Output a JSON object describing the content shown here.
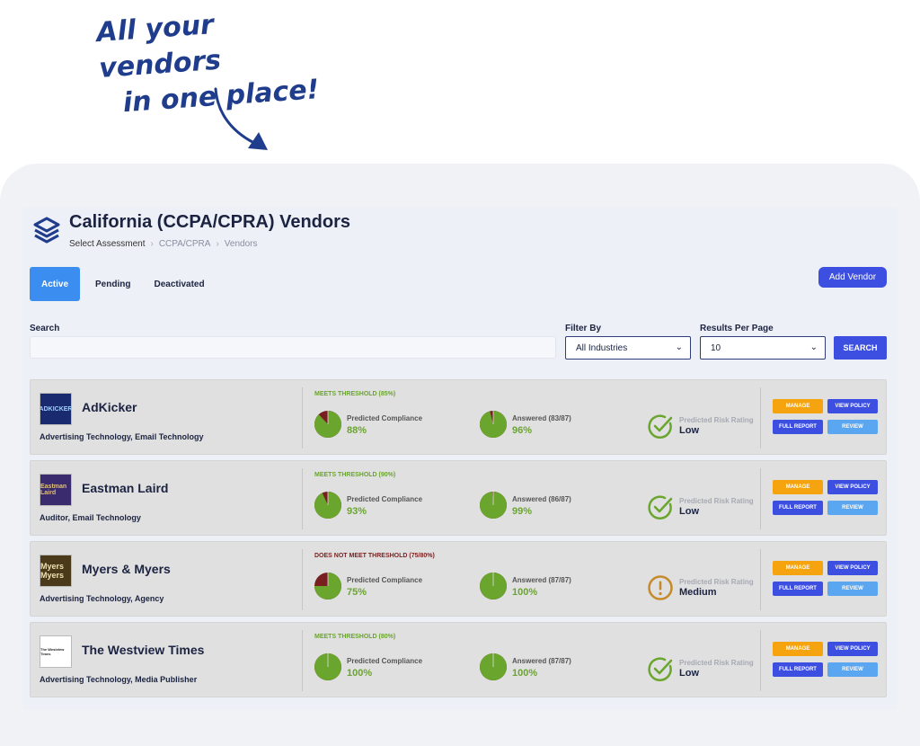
{
  "promo": {
    "line1": "All your vendors",
    "line2": "in one place!"
  },
  "header": {
    "title": "California (CCPA/CPRA) Vendors",
    "breadcrumb": [
      "Select Assessment",
      "CCPA/CPRA",
      "Vendors"
    ]
  },
  "tabs": [
    {
      "label": "Active",
      "active": true
    },
    {
      "label": "Pending",
      "active": false
    },
    {
      "label": "Deactivated",
      "active": false
    }
  ],
  "add_vendor_label": "Add Vendor",
  "filters": {
    "search_label": "Search",
    "search_value": "",
    "filter_by_label": "Filter By",
    "filter_by_value": "All Industries",
    "results_label": "Results Per Page",
    "results_value": "10",
    "search_button": "SEARCH"
  },
  "buttons": {
    "manage": "MANAGE",
    "view_policy": "VIEW POLICY",
    "full_report": "FULL REPORT",
    "review": "REVIEW"
  },
  "metric_labels": {
    "compliance": "Predicted Compliance",
    "risk": "Predicted Risk Rating"
  },
  "colors": {
    "accent": "#3d4fe0",
    "orange": "#f5a30f",
    "light_blue": "#5aa6f0",
    "green": "#6aa52e",
    "dark_red": "#7a1f1f",
    "warning": "#c68a2a"
  },
  "vendors": [
    {
      "name": "AdKicker",
      "logo_text": "ADKICKER",
      "categories": "Advertising Technology, Email Technology",
      "threshold": "MEETS THRESHOLD (85%)",
      "meets": true,
      "compliance_value": "88%",
      "compliance_fraction": 0.88,
      "answered_label": "Answered (83/87)",
      "answered_value": "96%",
      "answered_fraction": 0.96,
      "risk": "Low",
      "risk_icon": "check-circle-icon"
    },
    {
      "name": "Eastman Laird",
      "logo_text": "Eastman Laird",
      "categories": "Auditor, Email Technology",
      "threshold": "MEETS THRESHOLD (90%)",
      "meets": true,
      "compliance_value": "93%",
      "compliance_fraction": 0.93,
      "answered_label": "Answered (86/87)",
      "answered_value": "99%",
      "answered_fraction": 0.99,
      "risk": "Low",
      "risk_icon": "check-circle-icon"
    },
    {
      "name": "Myers & Myers",
      "logo_text": "Myers Myers",
      "categories": "Advertising Technology, Agency",
      "threshold": "DOES NOT MEET THRESHOLD (75/80%)",
      "meets": false,
      "compliance_value": "75%",
      "compliance_fraction": 0.75,
      "answered_label": "Answered (87/87)",
      "answered_value": "100%",
      "answered_fraction": 1.0,
      "risk": "Medium",
      "risk_icon": "exclamation-circle-icon"
    },
    {
      "name": "The Westview Times",
      "logo_text": "The Westview Times",
      "categories": "Advertising Technology, Media Publisher",
      "threshold": "MEETS THRESHOLD (80%)",
      "meets": true,
      "compliance_value": "100%",
      "compliance_fraction": 1.0,
      "answered_label": "Answered (87/87)",
      "answered_value": "100%",
      "answered_fraction": 1.0,
      "risk": "Low",
      "risk_icon": "check-circle-icon"
    }
  ]
}
